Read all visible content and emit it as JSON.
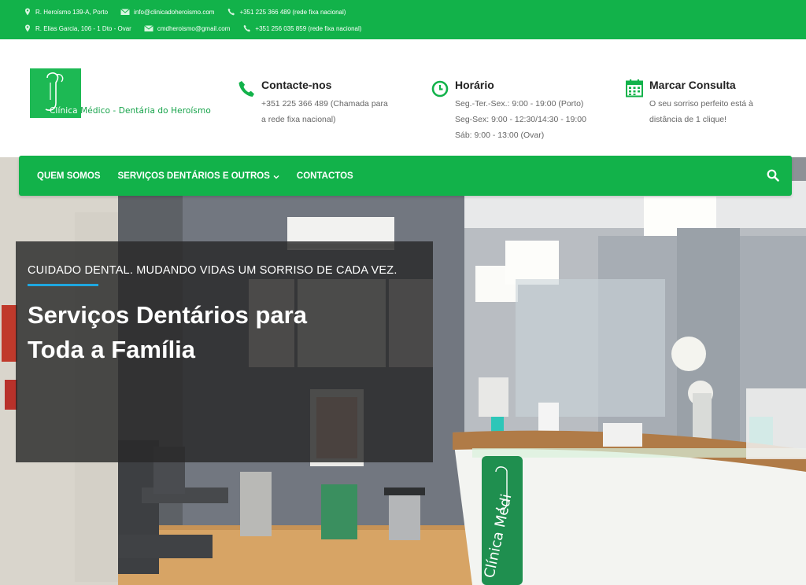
{
  "topbar": {
    "address1": "R. Heroísmo 139-A, Porto",
    "email1": "info@clinicadoheroismo.com",
    "phone1": "+351 225 366 489 (rede fixa nacional)",
    "address2": "R. Elias Garcia, 106 - 1 Dto - Ovar",
    "email2": "cmdheroismo@gmail.com",
    "phone2": "+351 256 035 859 (rede fixa nacional)"
  },
  "logo": {
    "text_white": "Clínica",
    "text_green": " Médico - Dentária do Heroísmo"
  },
  "info": {
    "contact": {
      "title": "Contacte-nos",
      "line1": "+351 225 366 489 (Chamada para",
      "line2": "a rede fixa nacional)"
    },
    "hours": {
      "title": "Horário",
      "line1": "Seg.-Ter.-Sex.: 9:00 - 19:00 (Porto)",
      "line2": "Seg-Sex: 9:00 - 12:30/14:30 - 19:00",
      "line3": "Sáb: 9:00 - 13:00 (Ovar)"
    },
    "booking": {
      "title": "Marcar Consulta",
      "line1": "O seu sorriso perfeito está à",
      "line2": "distância de 1 clique!"
    }
  },
  "nav": {
    "item1": "QUEM SOMOS",
    "item2": "SERVIÇOS DENTÁRIOS E OUTROS",
    "item3": "CONTACTOS"
  },
  "hero": {
    "tagline": "CUIDADO DENTAL. MUDANDO VIDAS UM SORRISO DE CADA VEZ.",
    "title_line1": "Serviços Dentários para",
    "title_line2": "Toda a Família",
    "sign_text": "Clínica Médi"
  },
  "colors": {
    "brand_green": "#12b24a",
    "accent_blue": "#1ea7e0"
  }
}
